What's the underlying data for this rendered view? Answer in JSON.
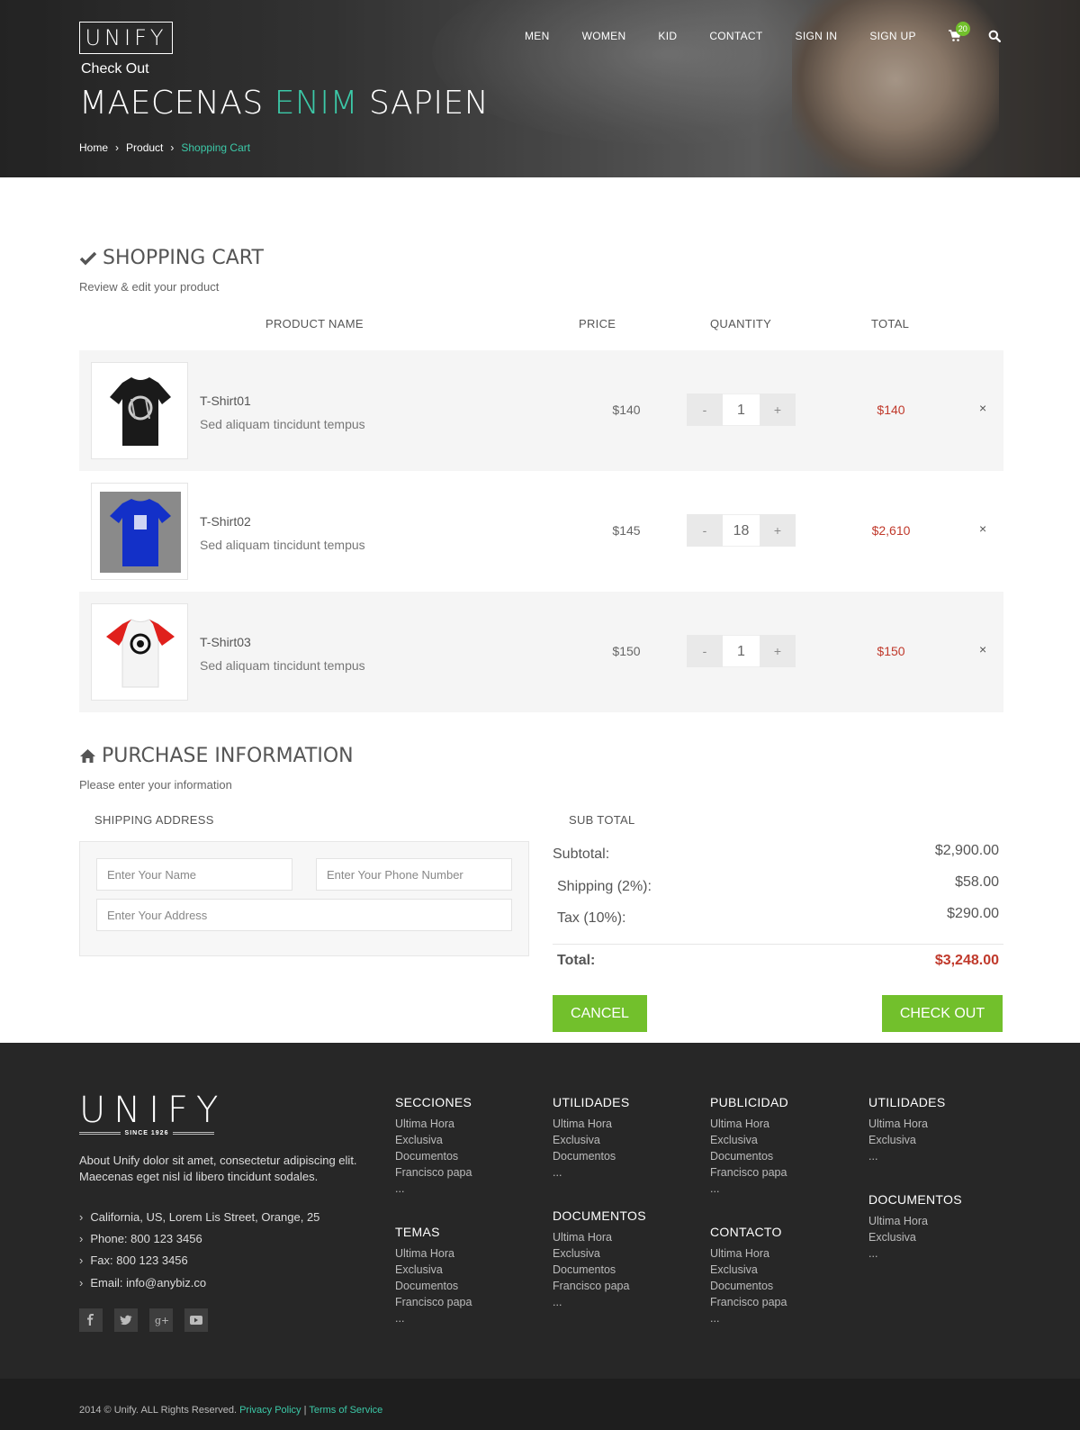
{
  "header": {
    "logo": "UNIFY",
    "nav": [
      "MEN",
      "WOMEN",
      "KID",
      "CONTACT",
      "SIGN IN",
      "SIGN UP"
    ],
    "cart_count": "20",
    "page_label": "Check Out",
    "title_part1": "MAECENAS",
    "title_highlight": "ENIM",
    "title_part2": "SAPIEN",
    "breadcrumb": [
      "Home",
      "Product",
      "Shopping Cart"
    ]
  },
  "cart": {
    "title": "SHOPPING CART",
    "subtitle": "Review & edit your product",
    "columns": [
      "PRODUCT NAME",
      "PRICE",
      "QUANTITY",
      "TOTAL"
    ],
    "items": [
      {
        "name": "T-Shirt01",
        "desc": "Sed aliquam tincidunt tempus",
        "price": "$140",
        "qty": "1",
        "total": "$140",
        "minus": "-",
        "plus": "+",
        "remove": "×"
      },
      {
        "name": "T-Shirt02",
        "desc": "Sed aliquam tincidunt tempus",
        "price": "$145",
        "qty": "18",
        "total": "$2,610",
        "minus": "-",
        "plus": "+",
        "remove": "×"
      },
      {
        "name": "T-Shirt03",
        "desc": "Sed aliquam tincidunt tempus",
        "price": "$150",
        "qty": "1",
        "total": "$150",
        "minus": "-",
        "plus": "+",
        "remove": "×"
      }
    ]
  },
  "purchase": {
    "title": "PURCHASE INFORMATION",
    "subtitle": "Please enter your information",
    "shipping_heading": "SHIPPING ADDRESS",
    "subtotal_heading": "SUB TOTAL",
    "name_placeholder": "Enter Your Name",
    "phone_placeholder": "Enter Your Phone Number",
    "address_placeholder": "Enter Your Address",
    "subtotal_label": "Subtotal:",
    "subtotal_value": "$2,900.00",
    "shipping_label": "Shipping (2%):",
    "shipping_value": "$58.00",
    "tax_label": "Tax (10%):",
    "tax_value": "$290.00",
    "total_label": "Total:",
    "total_value": "$3,248.00",
    "cancel_label": "CANCEL",
    "checkout_label": "CHECK OUT"
  },
  "footer": {
    "logo": "UNIFY",
    "since": "SINCE 1926",
    "about": "About Unify dolor sit amet, consectetur adipiscing elit. Maecenas eget nisl id libero tincidunt sodales.",
    "contacts": [
      "California, US, Lorem Lis Street, Orange, 25",
      "Phone: 800 123 3456",
      "Fax: 800 123 3456",
      "Email: info@anybiz.co"
    ],
    "social": [
      "f",
      "t",
      "g+",
      "yt"
    ],
    "columns": [
      {
        "title": "SECCIONES",
        "links": [
          "Ultima Hora",
          "Exclusiva",
          "Documentos",
          "Francisco papa",
          "..."
        ]
      },
      {
        "title": "TEMAS",
        "links": [
          "Ultima Hora",
          "Exclusiva",
          "Documentos",
          "Francisco papa",
          "..."
        ]
      },
      {
        "title": "UTILIDADES",
        "links": [
          "Ultima Hora",
          "Exclusiva",
          "Documentos",
          "..."
        ]
      },
      {
        "title": "DOCUMENTOS",
        "links": [
          "Ultima Hora",
          "Exclusiva",
          "Documentos",
          "Francisco papa",
          "..."
        ]
      },
      {
        "title": "PUBLICIDAD",
        "links": [
          "Ultima Hora",
          "Exclusiva",
          "Documentos",
          "Francisco papa",
          "..."
        ]
      },
      {
        "title": "CONTACTO",
        "links": [
          "Ultima Hora",
          "Exclusiva",
          "Documentos",
          "Francisco papa",
          "..."
        ]
      },
      {
        "title": "UTILIDADES",
        "links": [
          "Ultima Hora",
          "Exclusiva",
          "..."
        ]
      },
      {
        "title": "DOCUMENTOS",
        "links": [
          "Ultima Hora",
          "Exclusiva",
          "..."
        ]
      }
    ],
    "copyright": "2014 © Unify. ALL Rights Reserved.",
    "privacy": "Privacy Policy",
    "separator": "|",
    "terms": "Terms of Service"
  }
}
